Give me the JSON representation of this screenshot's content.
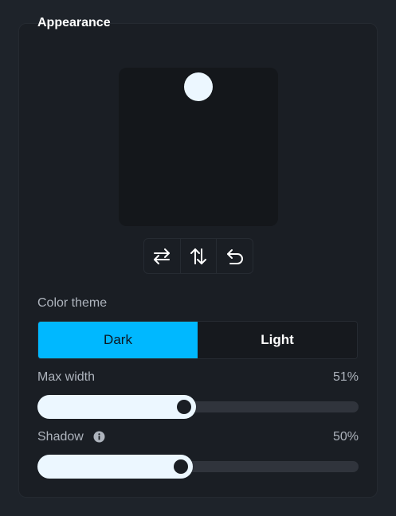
{
  "panel": {
    "title": "Appearance"
  },
  "preview_tools": [
    {
      "icon": "swap-horizontal-icon",
      "name": "flip-horizontal-button"
    },
    {
      "icon": "swap-vertical-icon",
      "name": "flip-vertical-button"
    },
    {
      "icon": "undo-icon",
      "name": "reset-button"
    }
  ],
  "color_theme": {
    "label": "Color theme",
    "options": [
      "Dark",
      "Light"
    ],
    "selected": "Dark"
  },
  "max_width": {
    "label": "Max width",
    "value_text": "51%",
    "value": 0.51
  },
  "shadow": {
    "label": "Shadow",
    "value_text": "50%",
    "value": 0.5,
    "info_icon": "info-icon"
  },
  "colors": {
    "accent": "#00b8ff",
    "slider_fill": "#ecf7ff",
    "panel_bg": "#1a1e24"
  }
}
